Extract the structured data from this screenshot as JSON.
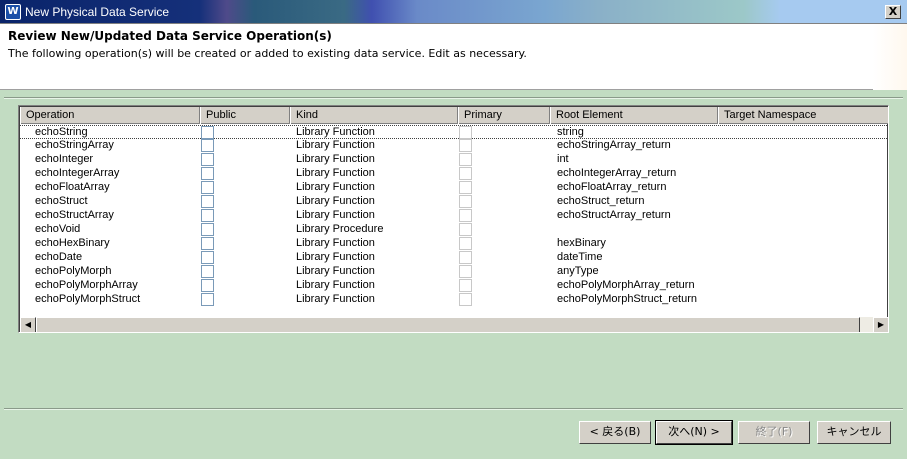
{
  "window": {
    "title": "New Physical Data Service",
    "icon": "app-icon",
    "close_label": "X"
  },
  "header": {
    "heading": "Review New/Updated Data Service Operation(s)",
    "description": "The following operation(s) will be created or added to existing data service. Edit as necessary."
  },
  "table": {
    "columns": [
      "Operation",
      "Public",
      "Kind",
      "Primary",
      "Root Element",
      "Target Namespace"
    ],
    "rows": [
      {
        "operation": "echoString",
        "kind": "Library Function",
        "root": "string"
      },
      {
        "operation": "echoStringArray",
        "kind": "Library Function",
        "root": "echoStringArray_return"
      },
      {
        "operation": "echoInteger",
        "kind": "Library Function",
        "root": "int"
      },
      {
        "operation": "echoIntegerArray",
        "kind": "Library Function",
        "root": "echoIntegerArray_return"
      },
      {
        "operation": "echoFloatArray",
        "kind": "Library Function",
        "root": "echoFloatArray_return"
      },
      {
        "operation": "echoStruct",
        "kind": "Library Function",
        "root": "echoStruct_return"
      },
      {
        "operation": "echoStructArray",
        "kind": "Library Function",
        "root": "echoStructArray_return"
      },
      {
        "operation": "echoVoid",
        "kind": "Library Procedure",
        "root": ""
      },
      {
        "operation": "echoHexBinary",
        "kind": "Library Function",
        "root": "hexBinary"
      },
      {
        "operation": "echoDate",
        "kind": "Library Function",
        "root": "dateTime"
      },
      {
        "operation": "echoPolyMorph",
        "kind": "Library Function",
        "root": "anyType"
      },
      {
        "operation": "echoPolyMorphArray",
        "kind": "Library Function",
        "root": "echoPolyMorphArray_return"
      },
      {
        "operation": "echoPolyMorphStruct",
        "kind": "Library Function",
        "root": "echoPolyMorphStruct_return"
      }
    ]
  },
  "scrollbar": {
    "left_arrow": "◀",
    "right_arrow": "▶"
  },
  "buttons": {
    "back": "< 戻る(B)",
    "next": "次へ(N) >",
    "finish": "終了(F)",
    "cancel": "キャンセル"
  }
}
